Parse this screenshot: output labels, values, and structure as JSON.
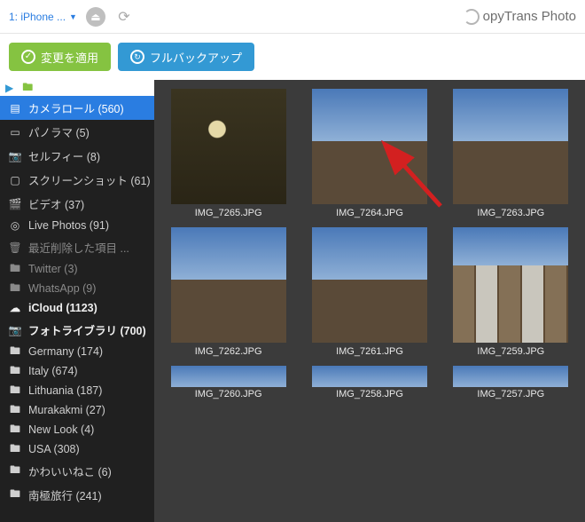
{
  "topbar": {
    "device_label": "1: iPhone ...",
    "brand_text": "opyTrans Photo",
    "brand_prefix": "C"
  },
  "actions": {
    "apply_label": "変更を適用",
    "backup_label": "フルバックアップ"
  },
  "sidebar": {
    "items": [
      {
        "icon": "album",
        "label": "カメラロール",
        "count": "(560)",
        "selected": true,
        "group": false,
        "faded": false
      },
      {
        "icon": "panorama",
        "label": "パノラマ",
        "count": "(5)",
        "selected": false,
        "group": false,
        "faded": false
      },
      {
        "icon": "camera",
        "label": "セルフィー",
        "count": "(8)",
        "selected": false,
        "group": false,
        "faded": false
      },
      {
        "icon": "screenshot",
        "label": "スクリーンショット",
        "count": "(61)",
        "selected": false,
        "group": false,
        "faded": false
      },
      {
        "icon": "video",
        "label": "ビデオ",
        "count": "(37)",
        "selected": false,
        "group": false,
        "faded": false
      },
      {
        "icon": "live",
        "label": "Live Photos",
        "count": "(91)",
        "selected": false,
        "group": false,
        "faded": false
      },
      {
        "icon": "trash",
        "label": "最近削除した項目 ...",
        "count": "",
        "selected": false,
        "group": false,
        "faded": true
      },
      {
        "icon": "folder",
        "label": "Twitter",
        "count": "(3)",
        "selected": false,
        "group": false,
        "faded": true
      },
      {
        "icon": "folder",
        "label": "WhatsApp",
        "count": "(9)",
        "selected": false,
        "group": false,
        "faded": true
      },
      {
        "icon": "cloud",
        "label": "iCloud",
        "count": "(1123)",
        "selected": false,
        "group": true,
        "faded": false
      },
      {
        "icon": "camera",
        "label": "フォトライブラリ",
        "count": "(700)",
        "selected": false,
        "group": true,
        "faded": false
      },
      {
        "icon": "folder",
        "label": "Germany",
        "count": "(174)",
        "selected": false,
        "group": false,
        "faded": false
      },
      {
        "icon": "folder",
        "label": "Italy",
        "count": "(674)",
        "selected": false,
        "group": false,
        "faded": false
      },
      {
        "icon": "folder",
        "label": "Lithuania",
        "count": "(187)",
        "selected": false,
        "group": false,
        "faded": false
      },
      {
        "icon": "folder",
        "label": "Murakakmi",
        "count": "(27)",
        "selected": false,
        "group": false,
        "faded": false
      },
      {
        "icon": "folder",
        "label": "New Look",
        "count": "(4)",
        "selected": false,
        "group": false,
        "faded": false
      },
      {
        "icon": "folder",
        "label": "USA",
        "count": "(308)",
        "selected": false,
        "group": false,
        "faded": false
      },
      {
        "icon": "folder",
        "label": "かわいいねこ",
        "count": "(6)",
        "selected": false,
        "group": false,
        "faded": false
      },
      {
        "icon": "folder",
        "label": "南極旅行",
        "count": "(241)",
        "selected": false,
        "group": false,
        "faded": false
      }
    ]
  },
  "thumbs": [
    {
      "label": "IMG_7265.JPG",
      "kind": "window"
    },
    {
      "label": "IMG_7264.JPG",
      "kind": "barn"
    },
    {
      "label": "IMG_7263.JPG",
      "kind": "barn"
    },
    {
      "label": "IMG_7262.JPG",
      "kind": "barn"
    },
    {
      "label": "IMG_7261.JPG",
      "kind": "barn"
    },
    {
      "label": "IMG_7259.JPG",
      "kind": "half"
    },
    {
      "label": "IMG_7260.JPG",
      "kind": "half",
      "partial": true
    },
    {
      "label": "IMG_7258.JPG",
      "kind": "half",
      "partial": true
    },
    {
      "label": "IMG_7257.JPG",
      "kind": "half",
      "partial": true
    }
  ],
  "icon_glyphs": {
    "album": "▤",
    "panorama": "▭",
    "camera": "📷",
    "screenshot": "▢",
    "video": "🎬",
    "live": "◎",
    "trash": "🗑",
    "folder": "🖿",
    "cloud": "☁"
  },
  "colors": {
    "accent_blue": "#3399d4",
    "accent_green": "#85c341",
    "select_blue": "#2a7de1",
    "arrow_red": "#d32020"
  }
}
